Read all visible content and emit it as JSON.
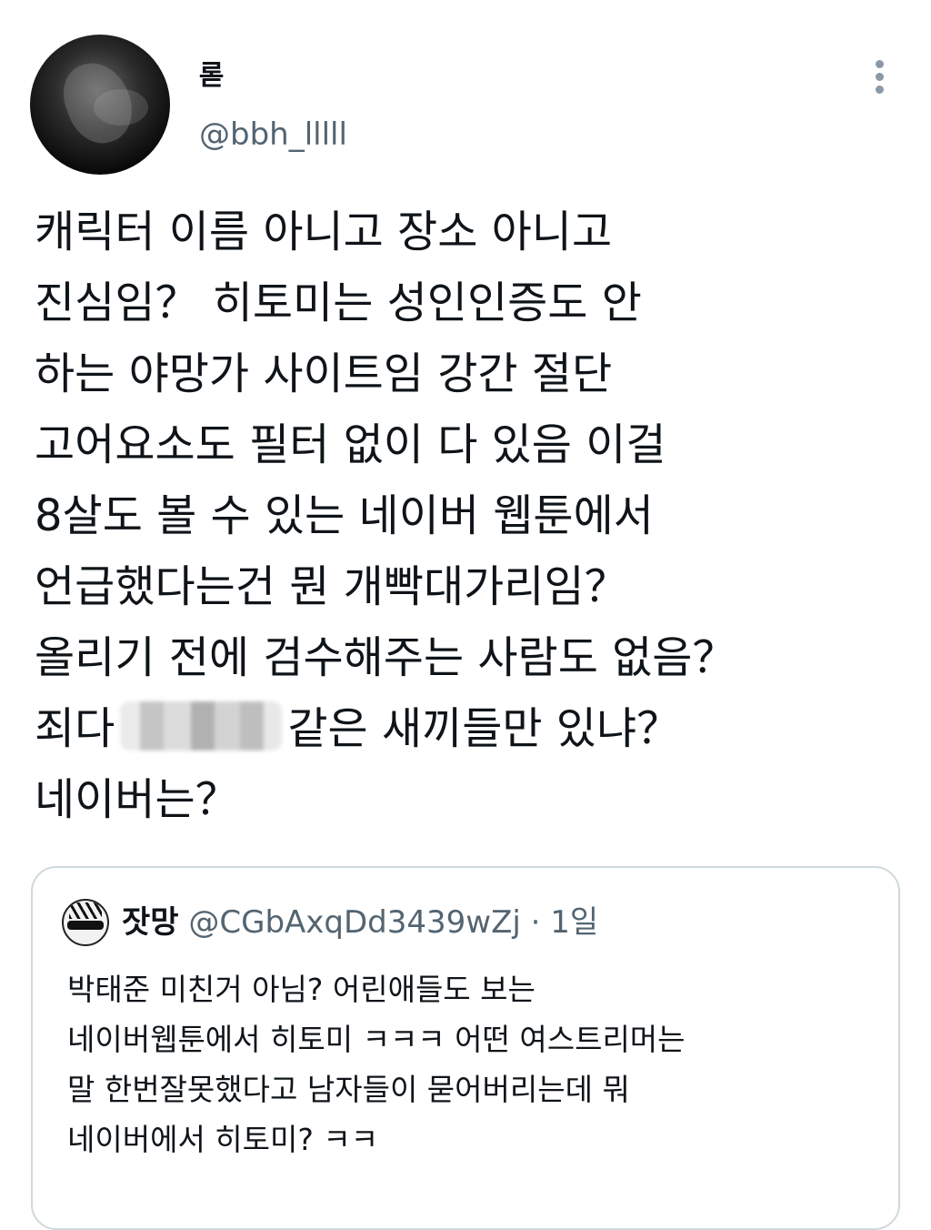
{
  "author": {
    "display_name": "롣",
    "handle": "@bbh_lllll"
  },
  "tweet": {
    "lines": [
      "캐릭터 이름 아니고 장소 아니고",
      "진심임？ 히토미는 성인인증도 안",
      "하는 야망가 사이트임 강간 절단",
      "고어요소도 필터 없이 다 있음  이걸",
      "8살도 볼 수 있는 네이버 웹툰에서",
      "언급했다는건 뭔 개빡대가리임？",
      "올리기 전에 검수해주는 사람도 없음？"
    ],
    "censored_line": {
      "before": "죄다",
      "after": "같은 새끼들만 있냐？"
    },
    "last_line": "네이버는？"
  },
  "quote": {
    "display_name": "잣망",
    "handle": "@CGbAxqDd3439wZj",
    "dot": "·",
    "time": "1일",
    "lines": [
      "박태준 미친거 아님? 어린애들도 보는",
      "네이버웹툰에서 히토미 ㅋㅋㅋ 어떤 여스트리머는",
      "말 한번잘못했다고 남자들이 묻어버리는데 뭐",
      "네이버에서 히토미? ㅋㅋ"
    ]
  },
  "icons": {
    "more": "more-vertical-icon",
    "censor": "censor-mosaic"
  },
  "colors": {
    "text": "#0f1419",
    "secondary": "#536471",
    "border": "#cfd9de"
  }
}
